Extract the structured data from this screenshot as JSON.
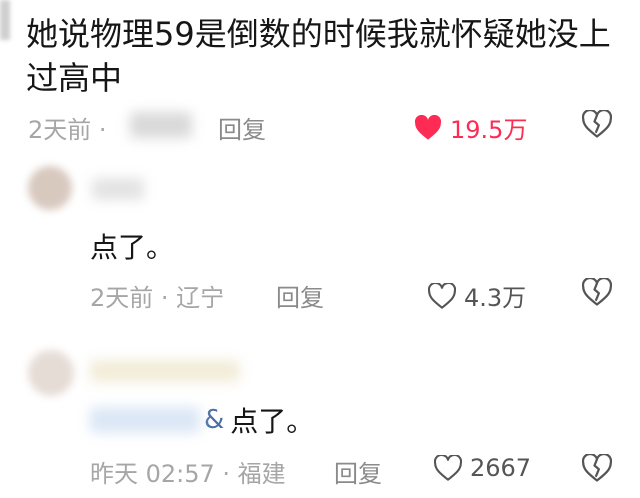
{
  "comments": [
    {
      "text_line1": "她说物理59是倒数的时候我就怀疑她没上",
      "text_line2": "过高中",
      "time": "2天前 ·",
      "location": "",
      "reply": "回复",
      "likes": "19.5万",
      "liked": true
    },
    {
      "text": "点了。",
      "time": "2天前 · 辽宁",
      "reply": "回复",
      "likes": "4.3万",
      "liked": false
    },
    {
      "mention_suffix": "&",
      "text": "点了。",
      "time": "昨天 02:57 · 福建",
      "reply": "回复",
      "likes": "2667",
      "liked": false
    }
  ],
  "colors": {
    "like_active": "#fe2c55",
    "meta": "#a6a6a6"
  },
  "icons": {
    "like": "heart-icon",
    "dislike": "broken-heart-icon"
  }
}
